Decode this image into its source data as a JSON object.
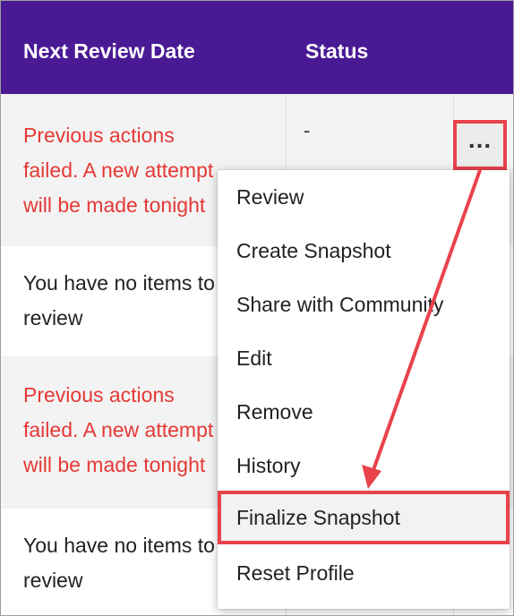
{
  "table": {
    "columns": {
      "next_review_date": "Next Review Date",
      "status": "Status"
    },
    "rows": [
      {
        "lines": [
          "Previous actions",
          "failed. A new attempt",
          "will be made tonight"
        ],
        "status": "-",
        "style": "error"
      },
      {
        "lines": [
          "You have no items to",
          "review"
        ],
        "status": "",
        "style": "normal"
      },
      {
        "lines": [
          "Previous actions",
          "failed. A new attempt",
          "will be made tonight"
        ],
        "status": "",
        "style": "error"
      },
      {
        "lines": [
          "You have no items to",
          "review"
        ],
        "status": "",
        "style": "normal"
      }
    ]
  },
  "actions_button": {
    "label": "...",
    "icon": "ellipsis-icon"
  },
  "context_menu": {
    "items": [
      {
        "label": "Review"
      },
      {
        "label": "Create Snapshot"
      },
      {
        "label": "Share with Community"
      },
      {
        "label": "Edit"
      },
      {
        "label": "Remove"
      },
      {
        "label": "History"
      },
      {
        "label": "Finalize Snapshot",
        "highlighted": true
      },
      {
        "label": "Reset Profile"
      }
    ]
  },
  "colors": {
    "header_bg": "#4a1a94",
    "error_text": "#e53935",
    "annotation": "#e8434b"
  }
}
